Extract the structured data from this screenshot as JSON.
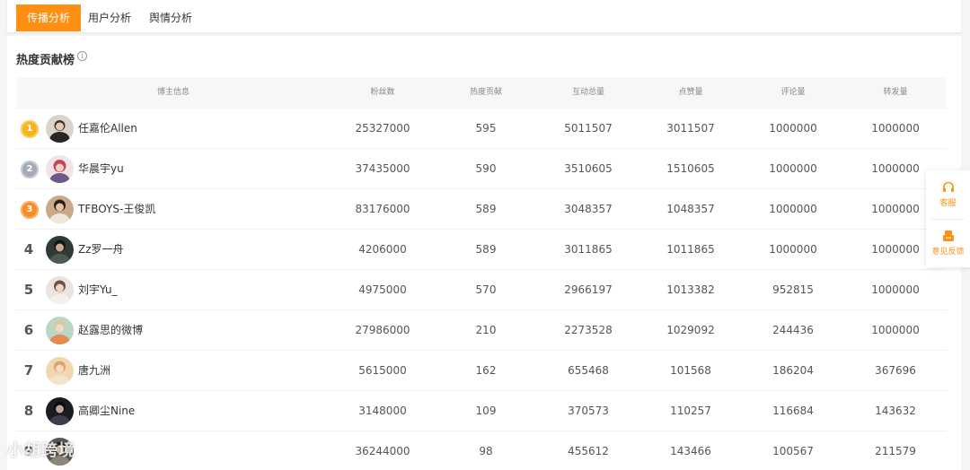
{
  "tabs": [
    {
      "label": "传播分析",
      "active": true
    },
    {
      "label": "用户分析",
      "active": false
    },
    {
      "label": "舆情分析",
      "active": false
    }
  ],
  "panel": {
    "title": "热度贡献榜",
    "info_glyph": "i"
  },
  "table": {
    "headers": {
      "user": "博主信息",
      "fans": "粉丝数",
      "heat": "热度贡献",
      "interactions": "互动总量",
      "likes": "点赞量",
      "comments": "评论量",
      "forwards": "转发量"
    },
    "rows": [
      {
        "rank": "1",
        "name": "任嘉伦Allen",
        "fans": "25327000",
        "heat": "595",
        "interactions": "5011507",
        "likes": "3011507",
        "comments": "1000000",
        "forwards": "1000000"
      },
      {
        "rank": "2",
        "name": "华晨宇yu",
        "fans": "37435000",
        "heat": "590",
        "interactions": "3510605",
        "likes": "1510605",
        "comments": "1000000",
        "forwards": "1000000"
      },
      {
        "rank": "3",
        "name": "TFBOYS-王俊凯",
        "fans": "83176000",
        "heat": "589",
        "interactions": "3048357",
        "likes": "1048357",
        "comments": "1000000",
        "forwards": "1000000"
      },
      {
        "rank": "4",
        "name": "Zz罗一舟",
        "fans": "4206000",
        "heat": "589",
        "interactions": "3011865",
        "likes": "1011865",
        "comments": "1000000",
        "forwards": "1000000"
      },
      {
        "rank": "5",
        "name": "刘宇Yu_",
        "fans": "4975000",
        "heat": "570",
        "interactions": "2966197",
        "likes": "1013382",
        "comments": "952815",
        "forwards": "1000000"
      },
      {
        "rank": "6",
        "name": "赵露思的微博",
        "fans": "27986000",
        "heat": "210",
        "interactions": "2273528",
        "likes": "1029092",
        "comments": "244436",
        "forwards": "1000000"
      },
      {
        "rank": "7",
        "name": "唐九洲",
        "fans": "5615000",
        "heat": "162",
        "interactions": "655468",
        "likes": "101568",
        "comments": "186204",
        "forwards": "367696"
      },
      {
        "rank": "8",
        "name": "高卿尘Nine",
        "fans": "3148000",
        "heat": "109",
        "interactions": "370573",
        "likes": "110257",
        "comments": "116684",
        "forwards": "143632"
      },
      {
        "rank": "9",
        "name": "",
        "fans": "36244000",
        "heat": "98",
        "interactions": "455612",
        "likes": "143466",
        "comments": "100567",
        "forwards": "211579"
      }
    ]
  },
  "float_panel": {
    "service_label": "客服",
    "feedback_label": "意见反馈",
    "icons": [
      "headset-icon",
      "feedback-icon"
    ],
    "color": "#ff8f12"
  },
  "watermark": {
    "text": "小胡跨境"
  },
  "colors": {
    "accent": "#ff8f12",
    "gold": "#f5b221",
    "silver": "#a4aab6",
    "bronze": "#f68c25"
  }
}
